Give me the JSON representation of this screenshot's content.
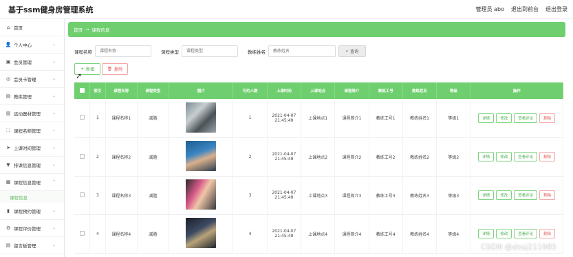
{
  "app": {
    "title": "基于ssm健身房管理系统"
  },
  "top_right": {
    "admin": "管理员 abo",
    "front": "退出到前台",
    "logout": "退出登录"
  },
  "sidebar": {
    "items": [
      {
        "label": "首页",
        "icon": "home-icon"
      },
      {
        "label": "个人中心",
        "icon": "user-icon"
      },
      {
        "label": "会员管理",
        "icon": "id-card-icon"
      },
      {
        "label": "会员卡管理",
        "icon": "card-icon"
      },
      {
        "label": "教练管理",
        "icon": "coach-icon"
      },
      {
        "label": "运动器材管理",
        "icon": "equipment-icon"
      },
      {
        "label": "课程名称管理",
        "icon": "course-icon"
      },
      {
        "label": "上课时间管理",
        "icon": "time-icon"
      },
      {
        "label": "排课信息管理",
        "icon": "schedule-icon"
      },
      {
        "label": "课程信息管理",
        "icon": "info-icon"
      },
      {
        "label": "课程预约管理",
        "icon": "booking-icon"
      },
      {
        "label": "课程评价管理",
        "icon": "review-icon"
      },
      {
        "label": "留言板管理",
        "icon": "message-icon"
      }
    ],
    "active_sub": "课程信息"
  },
  "breadcrumb": {
    "home": "首页",
    "separator": "→",
    "current": "课程信息"
  },
  "search": {
    "name_label": "课程名称",
    "name_placeholder": "课程名称",
    "type_label": "课程类型",
    "type_placeholder": "课程类型",
    "coach_label": "教练姓名",
    "coach_placeholder": "教练姓名",
    "button": "查询"
  },
  "actions": {
    "add": "新增",
    "delete": "删除"
  },
  "table": {
    "headers": [
      "索引",
      "课程名称",
      "课程类型",
      "图片",
      "可约人数",
      "上课时间",
      "上课地点",
      "课程简介",
      "教练工号",
      "教练姓名",
      "等级",
      "操作"
    ],
    "rows": [
      {
        "index": "1",
        "name": "课程名称1",
        "type": "减脂",
        "count": "1",
        "time": "2021-04-07 21:45:49",
        "place": "上课地点1",
        "intro": "课程简介1",
        "coach_id": "教练工号1",
        "coach_name": "教练姓名1",
        "level": "等级1"
      },
      {
        "index": "2",
        "name": "课程名称2",
        "type": "减脂",
        "count": "2",
        "time": "2021-04-07 21:45:49",
        "place": "上课地点2",
        "intro": "课程简介2",
        "coach_id": "教练工号2",
        "coach_name": "教练姓名2",
        "level": "等级2"
      },
      {
        "index": "3",
        "name": "课程名称3",
        "type": "减脂",
        "count": "3",
        "time": "2021-04-07 21:45:49",
        "place": "上课地点3",
        "intro": "课程简介3",
        "coach_id": "教练工号3",
        "coach_name": "教练姓名3",
        "level": "等级3"
      },
      {
        "index": "4",
        "name": "课程名称4",
        "type": "减脂",
        "count": "4",
        "time": "2021-04-07 21:45:49",
        "place": "上课地点4",
        "intro": "课程简介4",
        "coach_id": "教练工号4",
        "coach_name": "教练姓名4",
        "level": "等级4"
      }
    ],
    "row_buttons": {
      "detail": "详情",
      "edit": "修改",
      "review": "查看评论",
      "delete": "删除"
    }
  },
  "watermark": "CSDN @dxsj211985"
}
